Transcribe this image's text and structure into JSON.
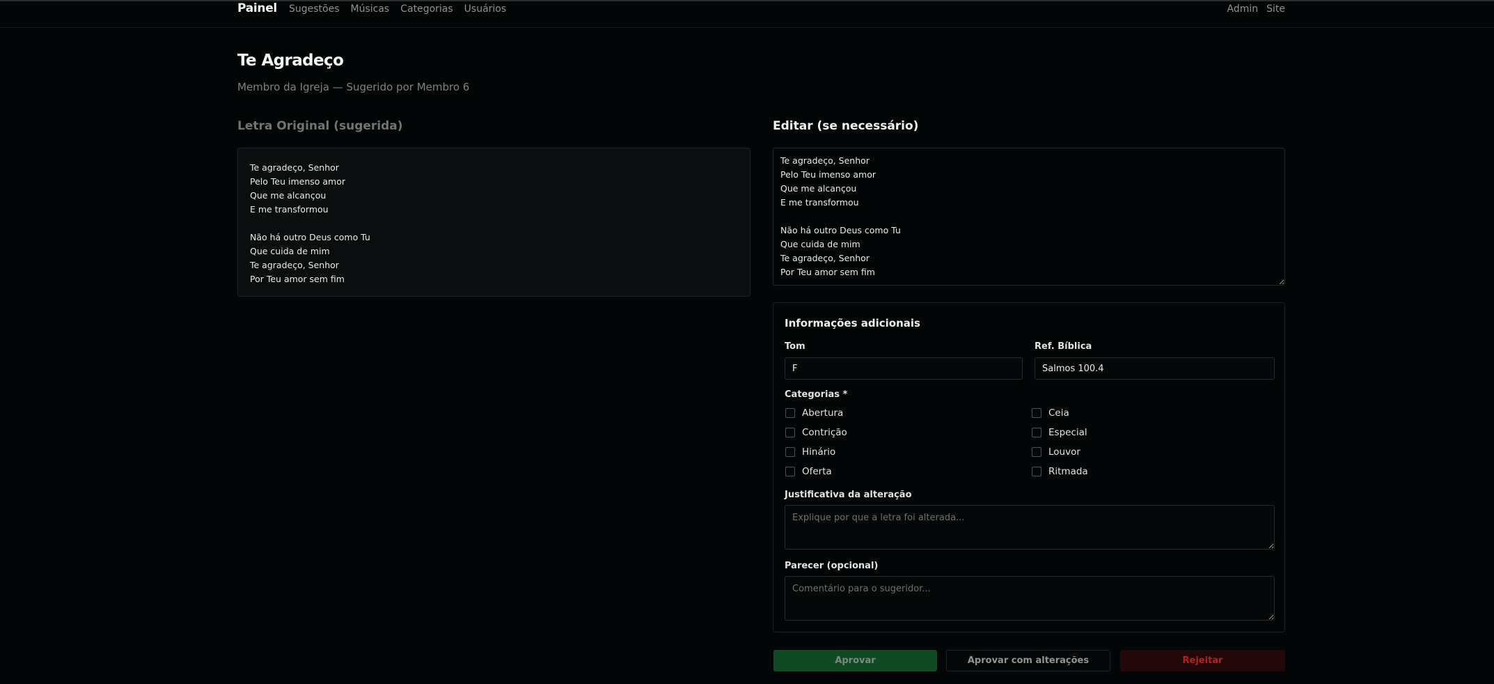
{
  "nav": {
    "brand": "Painel",
    "links": [
      "Sugestões",
      "Músicas",
      "Categorias",
      "Usuários"
    ],
    "right_links": [
      "Admin",
      "Site"
    ]
  },
  "page": {
    "title": "Te Agradeço",
    "subtitle": "Membro da Igreja — Sugerido por Membro 6"
  },
  "original": {
    "heading": "Letra Original (sugerida)",
    "lines": [
      "Te agradeço, Senhor",
      "Pelo Teu imenso amor",
      "Que me alcançou",
      "E me transformou",
      "",
      "Não há outro Deus como Tu",
      "Que cuida de mim",
      "Te agradeço, Senhor",
      "Por Teu amor sem fim"
    ]
  },
  "edit": {
    "heading": "Editar (se necessário)",
    "value": "Te agradeço, Senhor\nPelo Teu imenso amor\nQue me alcançou\nE me transformou\n\nNão há outro Deus como Tu\nQue cuida de mim\nTe agradeço, Senhor\nPor Teu amor sem fim"
  },
  "info": {
    "title": "Informações adicionais",
    "tom_label": "Tom",
    "tom_value": "F",
    "ref_label": "Ref. Bíblica",
    "ref_value": "Salmos 100.4",
    "categories_label": "Categorias *",
    "categories": [
      "Abertura",
      "Ceia",
      "Contrição",
      "Especial",
      "Hinário",
      "Louvor",
      "Oferta",
      "Ritmada"
    ],
    "justification_label": "Justificativa da alteração",
    "justification_placeholder": "Explique por que a letra foi alterada...",
    "opinion_label": "Parecer (opcional)",
    "opinion_placeholder": "Comentário para o sugeridor..."
  },
  "actions": {
    "approve": "Aprovar",
    "approve_changes": "Aprovar com alterações",
    "reject": "Rejeitar"
  },
  "colors": {
    "background": "#030606",
    "approve": "#0f4a22",
    "reject": "#220808",
    "reject_text": "#b12323"
  }
}
